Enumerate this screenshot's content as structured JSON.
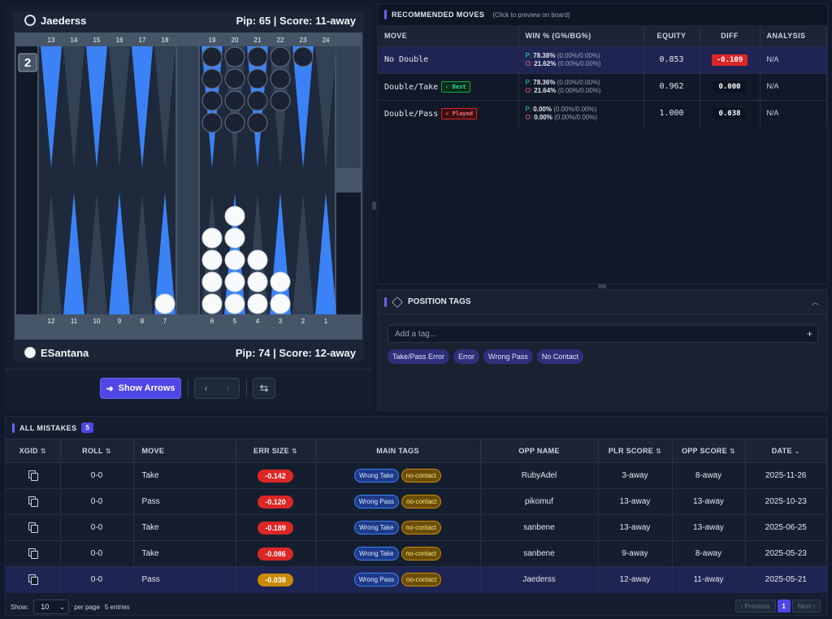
{
  "board": {
    "top_player": {
      "name": "Jaederss",
      "info": "Pip: 65 | Score: 11-away"
    },
    "bottom_player": {
      "name": "ESantana",
      "info": "Pip: 74 | Score: 12-away"
    },
    "cube_value": "2",
    "top_point_labels": [
      "13",
      "14",
      "15",
      "16",
      "17",
      "18",
      "19",
      "20",
      "21",
      "22",
      "23",
      "24"
    ],
    "bottom_point_labels": [
      "12",
      "11",
      "10",
      "9",
      "8",
      "7",
      "6",
      "5",
      "4",
      "3",
      "2",
      "1"
    ],
    "dark_checkers_top": [
      0,
      0,
      0,
      0,
      0,
      0,
      4,
      4,
      4,
      3,
      1,
      0
    ],
    "light_checkers_bottom": [
      0,
      0,
      0,
      0,
      0,
      1,
      4,
      5,
      3,
      2,
      0,
      0
    ],
    "colors": {
      "board_bg": "#1c2536",
      "frame": "#475569",
      "point_blue": "#3b82f6",
      "point_dark": "#334155",
      "checker_dark": "#1b2333",
      "checker_light": "#f8fafc"
    }
  },
  "controls": {
    "show_arrows": "Show Arrows",
    "prev": "‹",
    "next": "›",
    "swap": "⇆"
  },
  "moves": {
    "title": "RECOMMENDED MOVES",
    "subtitle": "(Click to preview on board)",
    "headers": [
      "MOVE",
      "WIN % (G%/BG%)",
      "EQUITY",
      "DIFF",
      "ANALYSIS"
    ],
    "rows": [
      {
        "move": "No Double",
        "badge": "",
        "p_label": "P:",
        "p": "78.38%",
        "p_sub": "(0.00%/0.00%)",
        "o_label": "O:",
        "o": "21.62%",
        "o_sub": "(0.00%/0.00%)",
        "equity": "0.853",
        "diff": "-0.109",
        "analysis": "N/A"
      },
      {
        "move": "Double/Take",
        "badge": "✓ Best",
        "p_label": "P:",
        "p": "78.36%",
        "p_sub": "(0.00%/0.00%)",
        "o_label": "O:",
        "o": "21.64%",
        "o_sub": "(0.00%/0.00%)",
        "equity": "0.962",
        "diff": "0.000",
        "analysis": "N/A"
      },
      {
        "move": "Double/Pass",
        "badge": "✕ Played",
        "p_label": "P:",
        "p": "0.00%",
        "p_sub": "(0.00%/0.00%)",
        "o_label": "O:",
        "o": "0.00%",
        "o_sub": "(0.00%/0.00%)",
        "equity": "1.000",
        "diff": "0.038",
        "analysis": "N/A"
      }
    ]
  },
  "tags": {
    "title": "POSITION TAGS",
    "placeholder": "Add a tag...",
    "items": [
      "Take/Pass Error",
      "Error",
      "Wrong Pass",
      "No Contact"
    ]
  },
  "mistakes": {
    "title": "ALL MISTAKES",
    "count": "5",
    "headers": [
      "XGID",
      "ROLL",
      "MOVE",
      "ERR SIZE",
      "MAIN TAGS",
      "OPP NAME",
      "PLR SCORE",
      "OPP SCORE",
      "DATE"
    ],
    "rows": [
      {
        "roll": "0-0",
        "move": "Take",
        "err": "-0.142",
        "tag1": "Wrong Take",
        "tag2": "no-contact",
        "opp": "RubyAdel",
        "plr_score": "3-away",
        "opp_score": "8-away",
        "date": "2025-11-26"
      },
      {
        "roll": "0-0",
        "move": "Pass",
        "err": "-0.120",
        "tag1": "Wrong Pass",
        "tag2": "no-contact",
        "opp": "pikomuf",
        "plr_score": "13-away",
        "opp_score": "13-away",
        "date": "2025-10-23"
      },
      {
        "roll": "0-0",
        "move": "Take",
        "err": "-0.189",
        "tag1": "Wrong Take",
        "tag2": "no-contact",
        "opp": "sanbene",
        "plr_score": "13-away",
        "opp_score": "13-away",
        "date": "2025-06-25"
      },
      {
        "roll": "0-0",
        "move": "Take",
        "err": "-0.086",
        "tag1": "Wrong Take",
        "tag2": "no-contact",
        "opp": "sanbene",
        "plr_score": "9-away",
        "opp_score": "8-away",
        "date": "2025-05-23"
      },
      {
        "roll": "0-0",
        "move": "Pass",
        "err": "-0.038",
        "tag1": "Wrong Pass",
        "tag2": "no-contact",
        "opp": "Jaederss",
        "plr_score": "12-away",
        "opp_score": "11-away",
        "date": "2025-05-21"
      }
    ],
    "footer": {
      "show_label": "Show:",
      "page_size": "10",
      "per_page": "per page",
      "entries": "5 entries",
      "previous": "‹ Previous",
      "page": "1",
      "next": "Next ›"
    }
  }
}
